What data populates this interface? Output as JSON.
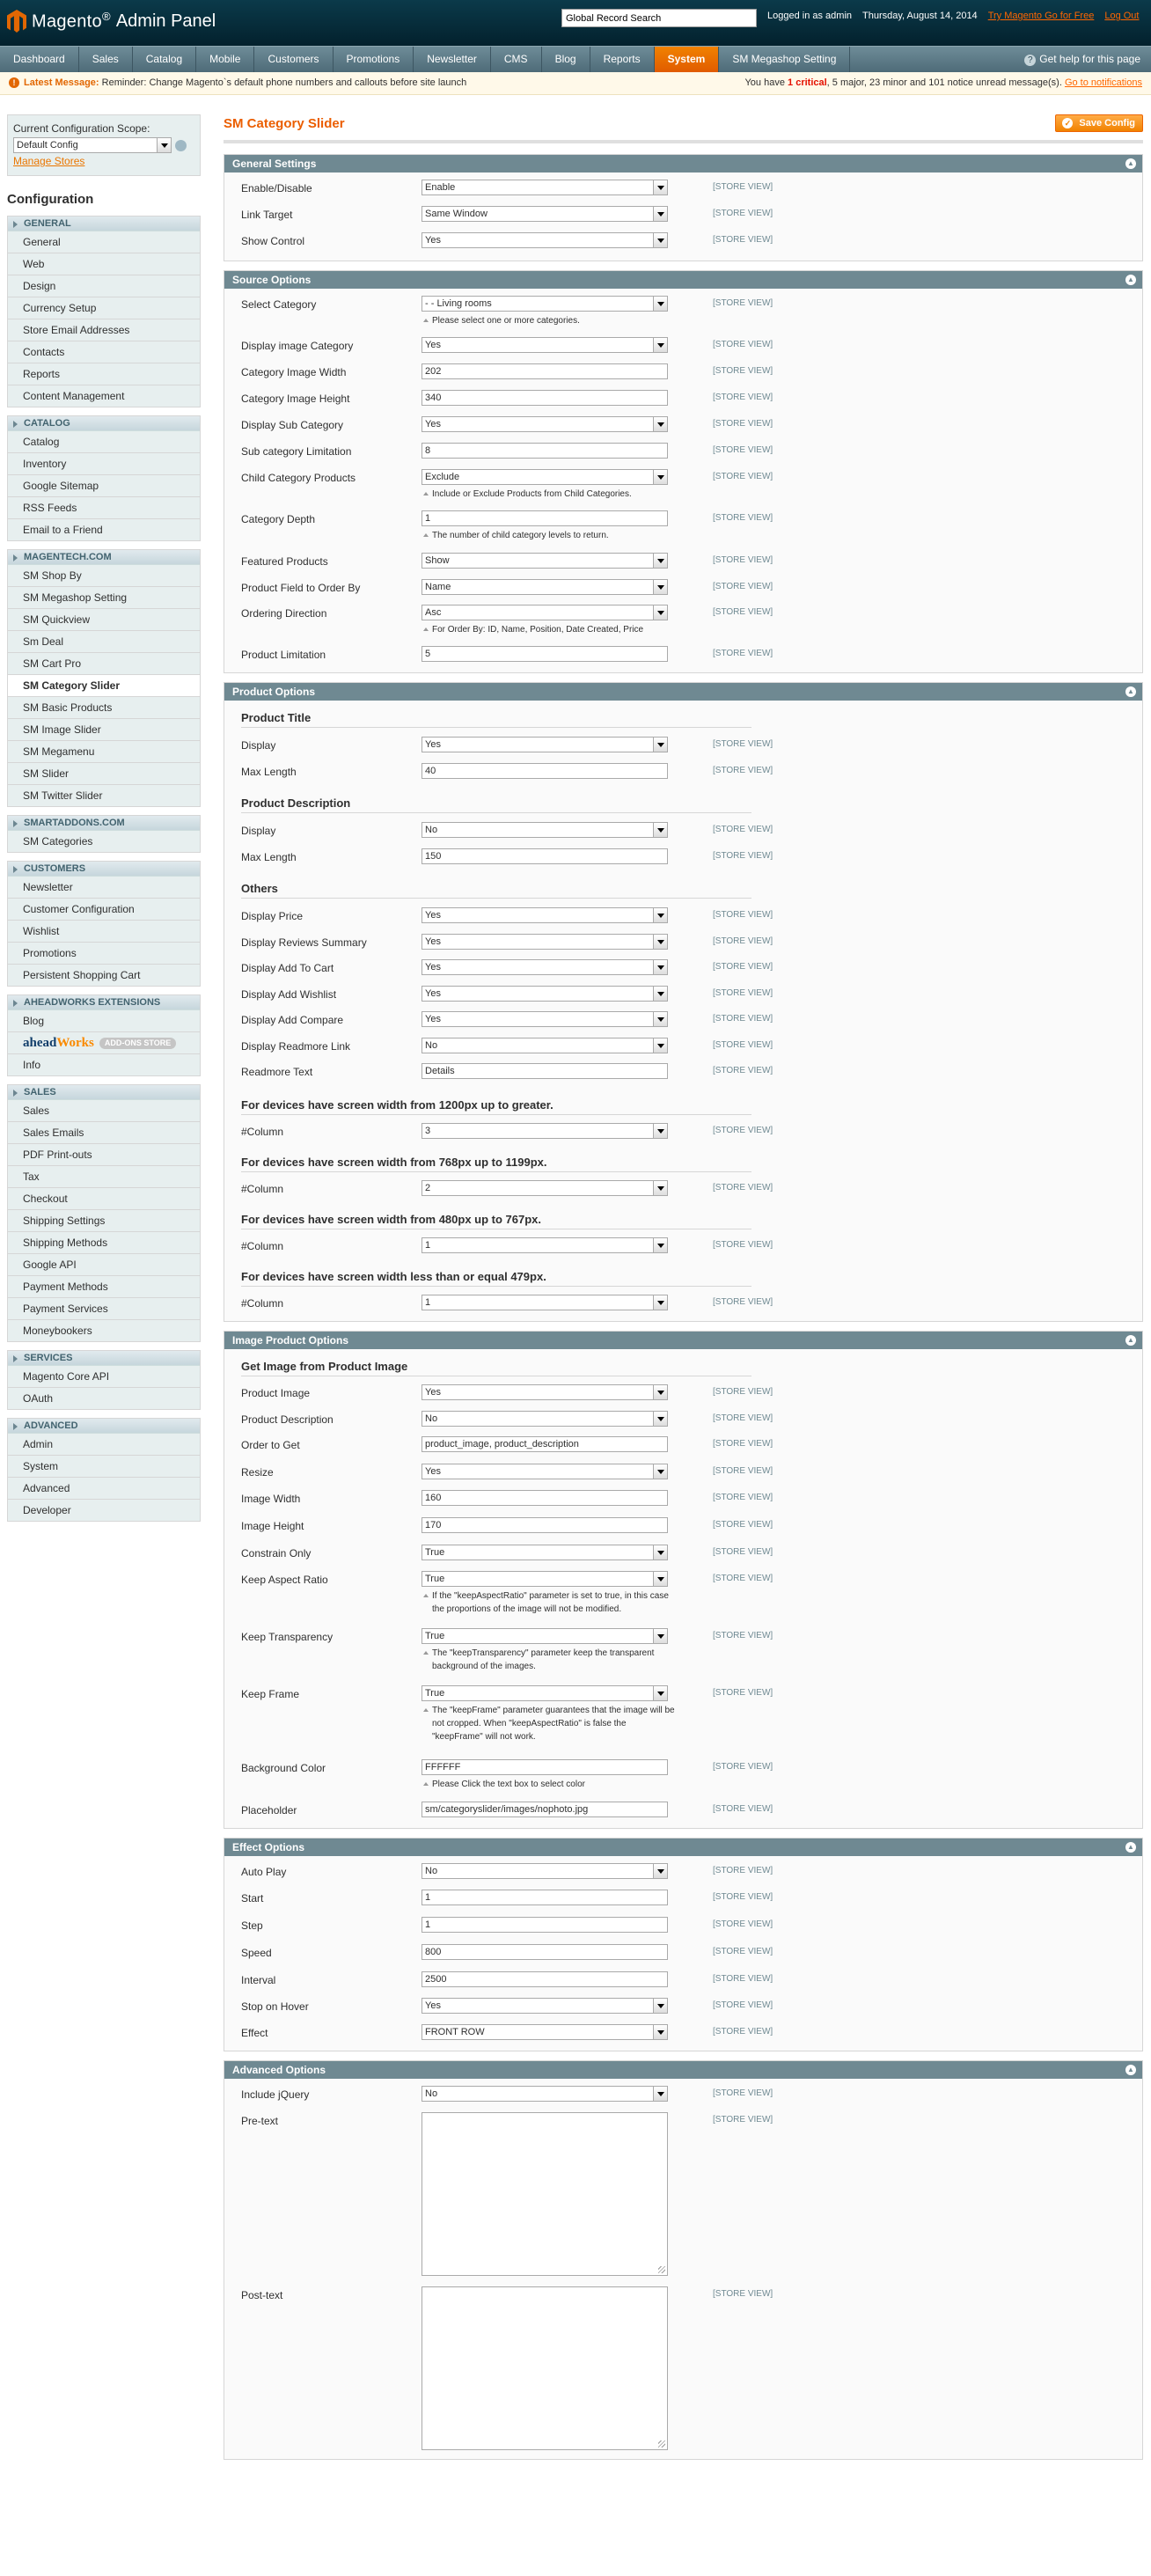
{
  "header": {
    "logo_text": "Magento",
    "logo_tm": "®",
    "panel_text": "Admin Panel",
    "search_value": "Global Record Search",
    "logged_in": "Logged in as admin",
    "date": "Thursday, August 14, 2014",
    "try_link": "Try Magento Go for Free",
    "logout": "Log Out"
  },
  "nav": {
    "items": [
      "Dashboard",
      "Sales",
      "Catalog",
      "Mobile",
      "Customers",
      "Promotions",
      "Newsletter",
      "CMS",
      "Blog",
      "Reports",
      "System",
      "SM Megashop Setting"
    ],
    "active": "System",
    "help": "Get help for this page"
  },
  "notice": {
    "label": "Latest Message:",
    "text": "Reminder: Change Magento`s default phone numbers and callouts before site launch",
    "right_pre": "You have",
    "critical_count": "1",
    "critical_word": "critical",
    "right_rest": ", 5 major, 23 minor and 101 notice unread message(s).",
    "link": "Go to notifications"
  },
  "sidebar": {
    "scope_label": "Current Configuration Scope:",
    "scope_value": "Default Config",
    "manage_stores": "Manage Stores",
    "config_title": "Configuration",
    "groups": [
      {
        "title": "General",
        "items": [
          "General",
          "Web",
          "Design",
          "Currency Setup",
          "Store Email Addresses",
          "Contacts",
          "Reports",
          "Content Management"
        ]
      },
      {
        "title": "Catalog",
        "items": [
          "Catalog",
          "Inventory",
          "Google Sitemap",
          "RSS Feeds",
          "Email to a Friend"
        ]
      },
      {
        "title": "Magentech.com",
        "items": [
          "SM Shop By",
          "SM Megashop Setting",
          "SM Quickview",
          "Sm Deal",
          "SM Cart Pro",
          "SM Category Slider",
          "SM Basic Products",
          "SM Image Slider",
          "SM Megamenu",
          "SM Slider",
          "SM Twitter Slider"
        ]
      },
      {
        "title": "Smartaddons.com",
        "items": [
          "SM Categories"
        ]
      },
      {
        "title": "Customers",
        "items": [
          "Newsletter",
          "Customer Configuration",
          "Wishlist",
          "Promotions",
          "Persistent Shopping Cart"
        ]
      },
      {
        "title": "Aheadworks Extensions",
        "items": [
          "Blog",
          "aheadWorks",
          "Info"
        ]
      },
      {
        "title": "Sales",
        "items": [
          "Sales",
          "Sales Emails",
          "PDF Print-outs",
          "Tax",
          "Checkout",
          "Shipping Settings",
          "Shipping Methods",
          "Google API",
          "Payment Methods",
          "Payment Services",
          "Moneybookers"
        ]
      },
      {
        "title": "Services",
        "items": [
          "Magento Core API",
          "OAuth"
        ]
      },
      {
        "title": "Advanced",
        "items": [
          "Admin",
          "System",
          "Advanced",
          "Developer"
        ]
      }
    ],
    "active_item": "SM Category Slider",
    "aw_logo_a": "ahead",
    "aw_logo_b": "Works",
    "aw_store": "ADD-ONS STORE"
  },
  "page": {
    "title": "SM Category Slider",
    "save_label": "Save Config",
    "scope_tag": "[STORE VIEW]"
  },
  "sections": {
    "general": {
      "title": "General Settings",
      "enable_l": "Enable/Disable",
      "enable_v": "Enable",
      "target_l": "Link Target",
      "target_v": "Same Window",
      "control_l": "Show Control",
      "control_v": "Yes"
    },
    "source": {
      "title": "Source Options",
      "selcat_l": "Select Category",
      "selcat_v": "- - Living rooms",
      "selcat_n": "Please select one or more categories.",
      "dispimg_l": "Display image Category",
      "dispimg_v": "Yes",
      "imgw_l": "Category Image Width",
      "imgw_v": "202",
      "imgh_l": "Category Image Height",
      "imgh_v": "340",
      "dispsub_l": "Display Sub Category",
      "dispsub_v": "Yes",
      "sublim_l": "Sub category Limitation",
      "sublim_v": "8",
      "child_l": "Child Category Products",
      "child_v": "Exclude",
      "child_n": "Include or Exclude Products from Child Categories.",
      "depth_l": "Category Depth",
      "depth_v": "1",
      "depth_n": "The number of child category levels to return.",
      "feat_l": "Featured Products",
      "feat_v": "Show",
      "field_l": "Product Field to Order By",
      "field_v": "Name",
      "dir_l": "Ordering Direction",
      "dir_v": "Asc",
      "dir_n": "For Order By: ID, Name, Position, Date Created, Price",
      "plim_l": "Product Limitation",
      "plim_v": "5"
    },
    "product": {
      "title": "Product Options",
      "h_title": "Product Title",
      "t_disp_l": "Display",
      "t_disp_v": "Yes",
      "t_max_l": "Max Length",
      "t_max_v": "40",
      "h_desc": "Product Description",
      "d_disp_l": "Display",
      "d_disp_v": "No",
      "d_max_l": "Max Length",
      "d_max_v": "150",
      "h_others": "Others",
      "price_l": "Display Price",
      "price_v": "Yes",
      "rev_l": "Display Reviews Summary",
      "rev_v": "Yes",
      "cart_l": "Display Add To Cart",
      "cart_v": "Yes",
      "wish_l": "Display Add Wishlist",
      "wish_v": "Yes",
      "comp_l": "Display Add Compare",
      "comp_v": "Yes",
      "rm_l": "Display Readmore Link",
      "rm_v": "No",
      "rmt_l": "Readmore Text",
      "rmt_v": "Details",
      "h_1200": "For devices have screen width from 1200px up to greater.",
      "c1_l": "#Column",
      "c1_v": "3",
      "h_768": "For devices have screen width from 768px up to 1199px.",
      "c2_l": "#Column",
      "c2_v": "2",
      "h_480": "For devices have screen width from 480px up to 767px.",
      "c3_l": "#Column",
      "c3_v": "1",
      "h_479": "For devices have screen width less than or equal 479px.",
      "c4_l": "#Column",
      "c4_v": "1"
    },
    "image": {
      "title": "Image Product Options",
      "h_get": "Get Image from Product Image",
      "pimg_l": "Product Image",
      "pimg_v": "Yes",
      "pdesc_l": "Product Description",
      "pdesc_v": "No",
      "order_l": "Order to Get",
      "order_v": "product_image, product_description",
      "resize_l": "Resize",
      "resize_v": "Yes",
      "iw_l": "Image Width",
      "iw_v": "160",
      "ih_l": "Image Height",
      "ih_v": "170",
      "co_l": "Constrain Only",
      "co_v": "True",
      "kar_l": "Keep Aspect Ratio",
      "kar_v": "True",
      "kar_n": "If the \"keepAspectRatio\" parameter is set to true, in this case the proportions of the image will not be modified.",
      "kt_l": "Keep Transparency",
      "kt_v": "True",
      "kt_n": "The \"keepTransparency\" parameter keep the transparent background of the images.",
      "kf_l": "Keep Frame",
      "kf_v": "True",
      "kf_n": "The \"keepFrame\" parameter guarantees that the image will be not cropped. When \"keepAspectRatio\" is false the \"keepFrame\" will not work.",
      "bg_l": "Background Color",
      "bg_v": "FFFFFF",
      "bg_n": "Please Click the text box to select color",
      "ph_l": "Placeholder",
      "ph_v": "sm/categoryslider/images/nophoto.jpg"
    },
    "effect": {
      "title": "Effect Options",
      "ap_l": "Auto Play",
      "ap_v": "No",
      "st_l": "Start",
      "st_v": "1",
      "sp_l": "Step",
      "sp_v": "1",
      "spd_l": "Speed",
      "spd_v": "800",
      "int_l": "Interval",
      "int_v": "2500",
      "soh_l": "Stop on Hover",
      "soh_v": "Yes",
      "eff_l": "Effect",
      "eff_v": "FRONT ROW"
    },
    "advanced": {
      "title": "Advanced Options",
      "jq_l": "Include jQuery",
      "jq_v": "No",
      "pre_l": "Pre-text",
      "pre_v": "",
      "post_l": "Post-text",
      "post_v": ""
    }
  },
  "colors": {
    "header_bg": "#03212d",
    "nav_active": "#f18200",
    "section_head": "#6f8992",
    "title_orange": "#eb5e00"
  }
}
